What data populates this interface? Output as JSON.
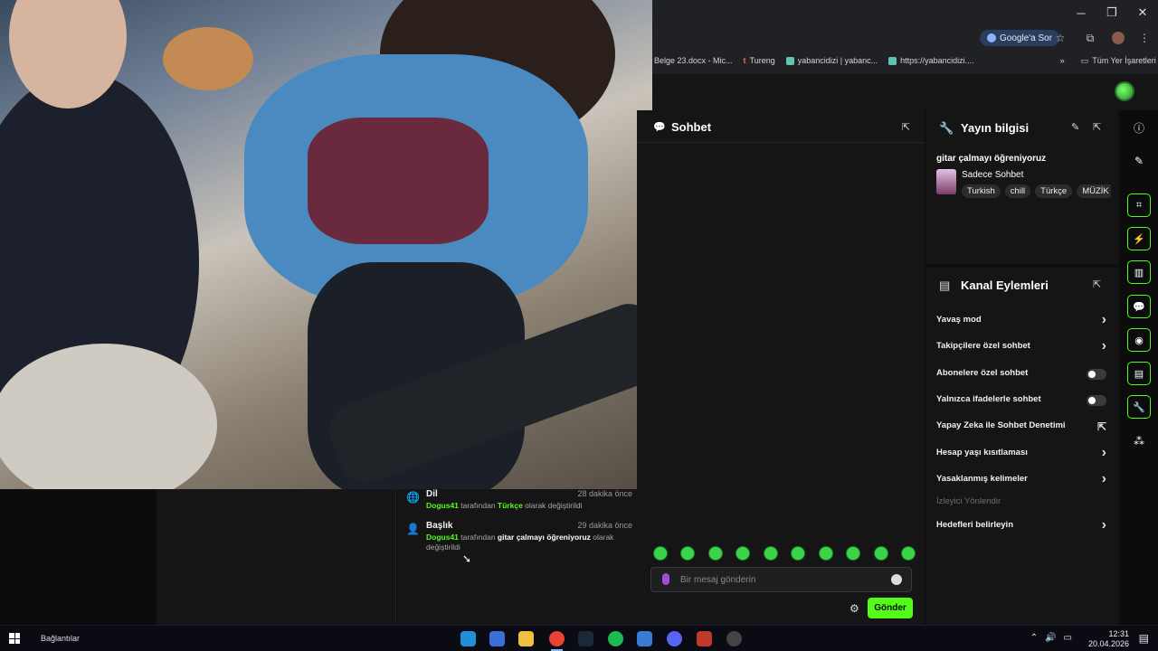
{
  "window_controls": {
    "minimize": "─",
    "maximize": "❐",
    "close": "✕"
  },
  "toolbar": {
    "google_button": "Google'a Sor",
    "star": "☆",
    "extensions": "⧉",
    "menu": "⋮"
  },
  "bookmarks": {
    "items": [
      "Belge 23.docx - Mic...",
      "Tureng",
      "yabancidizi | yabanc...",
      "https://yabancidizi...."
    ],
    "overflow": "»",
    "all_bookmarks": "Tüm Yer İşaretleri"
  },
  "activity": [
    {
      "title": "Dil",
      "time": "28 dakika önce",
      "user": "Dogus41",
      "mid": " tarafından ",
      "value": "Türkçe",
      "tail": " olarak değiştirildi"
    },
    {
      "title": "Başlık",
      "time": "29 dakika önce",
      "user": "Dogus41",
      "mid": " tarafından ",
      "value": "gitar çalmayı öğreniyoruz",
      "tail": " olarak değiştirildi"
    }
  ],
  "chat": {
    "title": "Sohbet",
    "placeholder": "Bir mesaj gönderin",
    "send_label": "Gönder",
    "gear": "⚙",
    "emotes": [
      "emote-1",
      "emote-2",
      "emote-3",
      "emote-4",
      "emote-5",
      "emote-6",
      "emote-7",
      "emote-8",
      "emote-9",
      "emote-10"
    ]
  },
  "stream_info": {
    "title": "Yayın bilgisi",
    "stream_title": "gitar çalmayı öğreniyoruz",
    "category": "Sadece Sohbet",
    "tags": [
      "Turkish",
      "chill",
      "Türkçe",
      "MÜZİK"
    ]
  },
  "channel_actions": {
    "title": "Kanal Eylemleri",
    "items": [
      {
        "label": "Yavaş mod",
        "control": "arrow"
      },
      {
        "label": "Takipçilere özel sohbet",
        "control": "arrow"
      },
      {
        "label": "Abonelere özel sohbet",
        "control": "toggle"
      },
      {
        "label": "Yalnızca ifadelerle sohbet",
        "control": "toggle"
      },
      {
        "label": "Yapay Zeka ile Sohbet Denetimi",
        "control": "external"
      },
      {
        "label": "Hesap yaşı kısıtlaması",
        "control": "arrow"
      },
      {
        "label": "Yasaklanmış kelimeler",
        "control": "arrow"
      },
      {
        "label": "İzleyici Yönlendir",
        "control": "none"
      },
      {
        "label": "Hedefleri belirleyin",
        "control": "arrow"
      }
    ]
  },
  "taskbar": {
    "label": "Bağlantılar",
    "time": "12:31",
    "date": "20.04.2026",
    "apps": [
      "edge-icon",
      "store-icon",
      "explorer-icon",
      "chrome-icon",
      "steam-icon",
      "spotify-icon",
      "app-icon",
      "discord-icon",
      "voicemeeter-icon",
      "obs-icon"
    ]
  },
  "colors": {
    "accent": "#53fc18",
    "panel": "#151516",
    "background": "#0f0f10"
  }
}
